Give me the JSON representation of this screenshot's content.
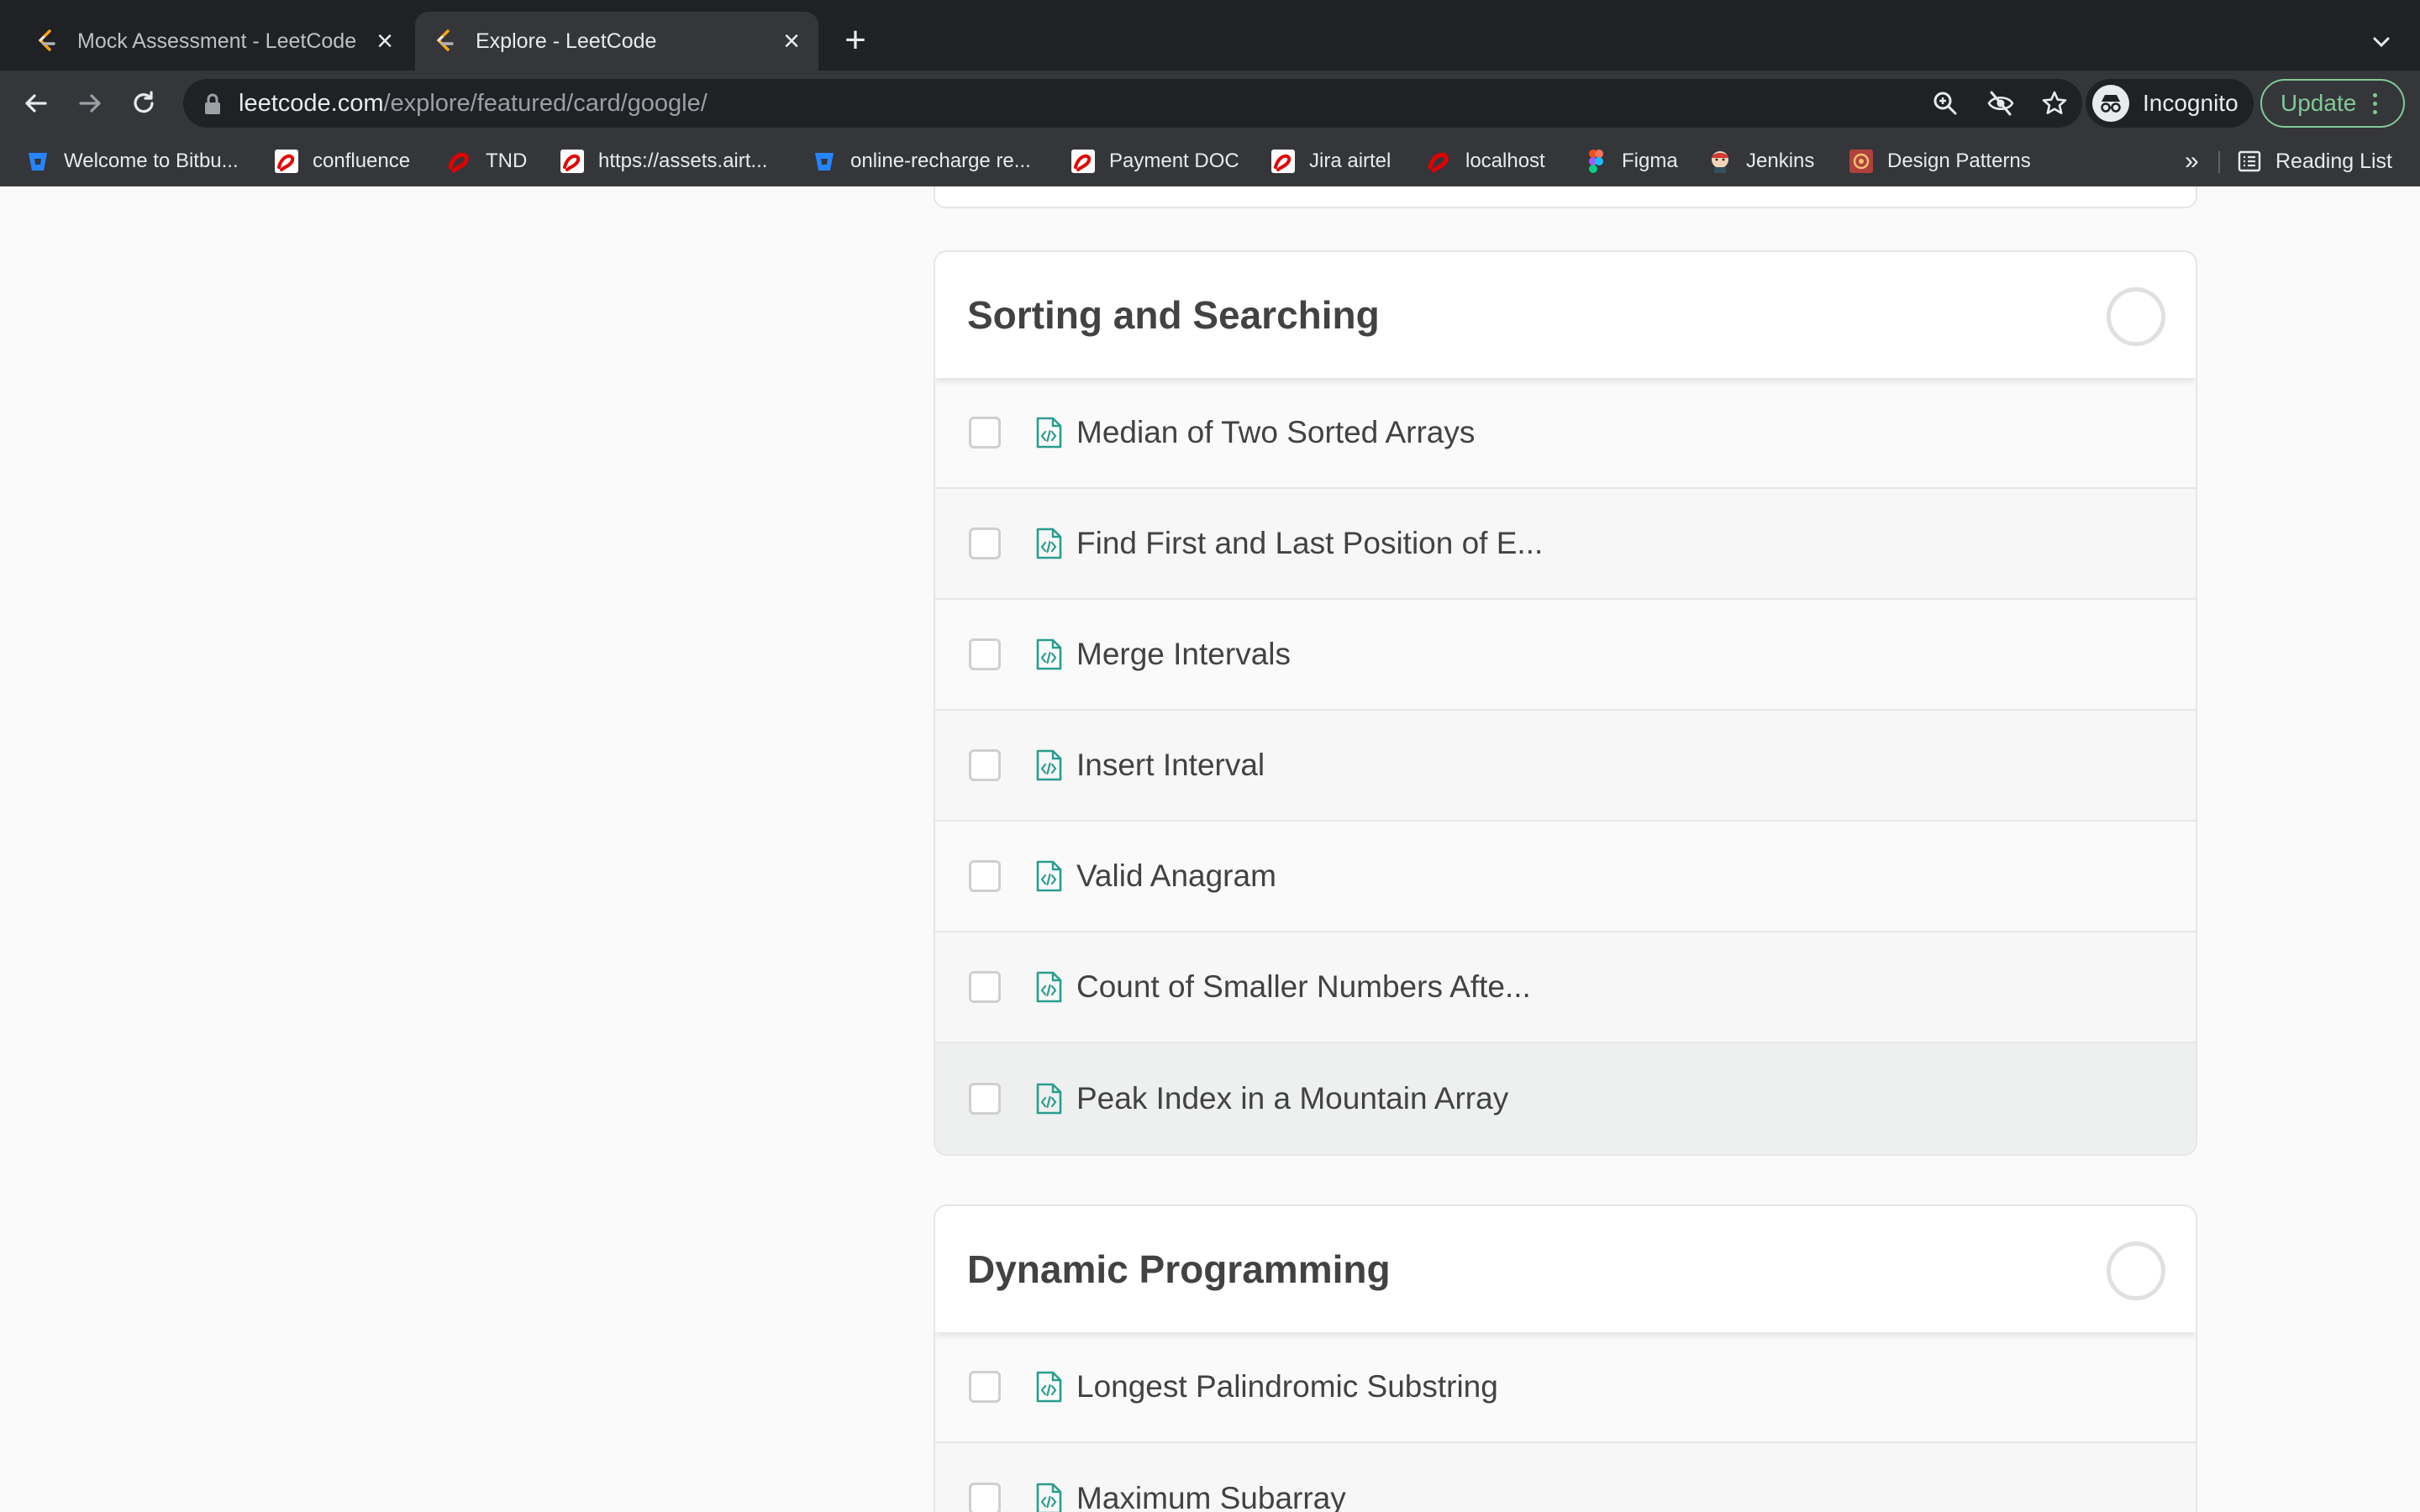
{
  "browser": {
    "tabs": [
      {
        "title": "Mock Assessment - LeetCode",
        "active": false
      },
      {
        "title": "Explore - LeetCode",
        "active": true
      }
    ],
    "url_host": "leetcode.com",
    "url_path": "/explore/featured/card/google/",
    "profile_label": "Incognito",
    "update_label": "Update",
    "bookmarks": [
      {
        "label": "Welcome to Bitbu...",
        "icon": "bitbucket-icon"
      },
      {
        "label": "confluence",
        "icon": "airtel-icon"
      },
      {
        "label": "TND",
        "icon": "airtel-icon"
      },
      {
        "label": "https://assets.airt...",
        "icon": "airtel-icon"
      },
      {
        "label": "online-recharge re...",
        "icon": "bitbucket-icon"
      },
      {
        "label": "Payment DOC",
        "icon": "airtel-icon"
      },
      {
        "label": "Jira airtel",
        "icon": "airtel-icon"
      },
      {
        "label": "localhost",
        "icon": "airtel-icon"
      },
      {
        "label": "Figma",
        "icon": "figma-icon"
      },
      {
        "label": "Jenkins",
        "icon": "jenkins-icon"
      },
      {
        "label": "Design Patterns",
        "icon": "design-patterns-icon"
      }
    ],
    "bookmarks_overflow": "»",
    "reading_list_label": "Reading List"
  },
  "sections": [
    {
      "title": "Sorting and Searching",
      "items": [
        "Median of Two Sorted Arrays",
        "Find First and Last Position of E...",
        "Merge Intervals",
        "Insert Interval",
        "Valid Anagram",
        "Count of Smaller Numbers Afte...",
        "Peak Index in a Mountain Array"
      ]
    },
    {
      "title": "Dynamic Programming",
      "items": [
        "Longest Palindromic Substring",
        "Maximum Subarray"
      ]
    }
  ],
  "colors": {
    "accent_teal": "#2a9d8f",
    "update_green": "#81c995",
    "chrome_dark": "#202124",
    "chrome_toolbar": "#35363a"
  }
}
